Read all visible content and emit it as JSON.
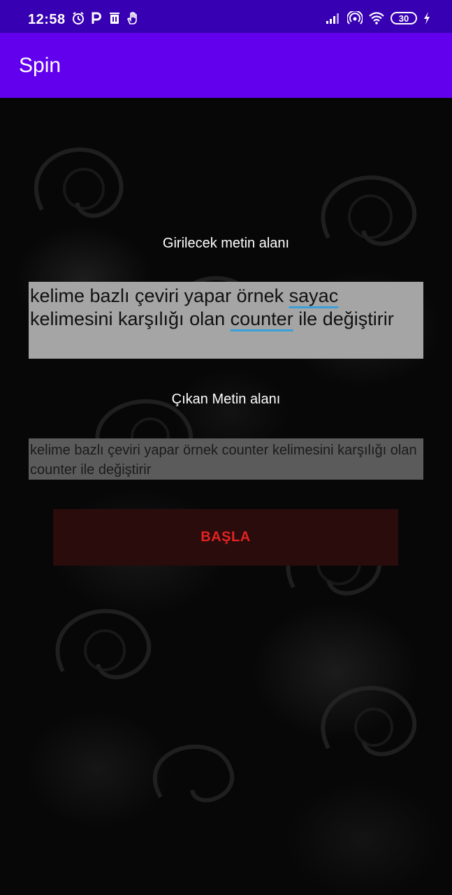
{
  "status_bar": {
    "time": "12:58",
    "battery_level": "30",
    "left_icons": [
      "alarm-icon",
      "p-icon",
      "trash-icon",
      "hand-icon"
    ],
    "right_icons": [
      "signal-icon",
      "hotspot-icon",
      "wifi-icon",
      "battery-icon",
      "charging-icon"
    ]
  },
  "app_bar": {
    "title": "Spin",
    "color": "#6200ee"
  },
  "input_section": {
    "label": "Girilecek metin alanı",
    "text_part1": "kelime bazlı çeviri yapar örnek ",
    "text_word1": "sayac",
    "text_part2": " kelimesini karşılığı olan ",
    "text_word2": "counter",
    "text_part3": " ile değiştirir"
  },
  "output_section": {
    "label": "Çıkan Metin alanı",
    "text": " kelime bazlı çeviri yapar örnek counter kelimesini karşılığı olan counter ile değiştirir"
  },
  "start_button": {
    "label": "BAŞLA",
    "text_color": "#e32222"
  }
}
